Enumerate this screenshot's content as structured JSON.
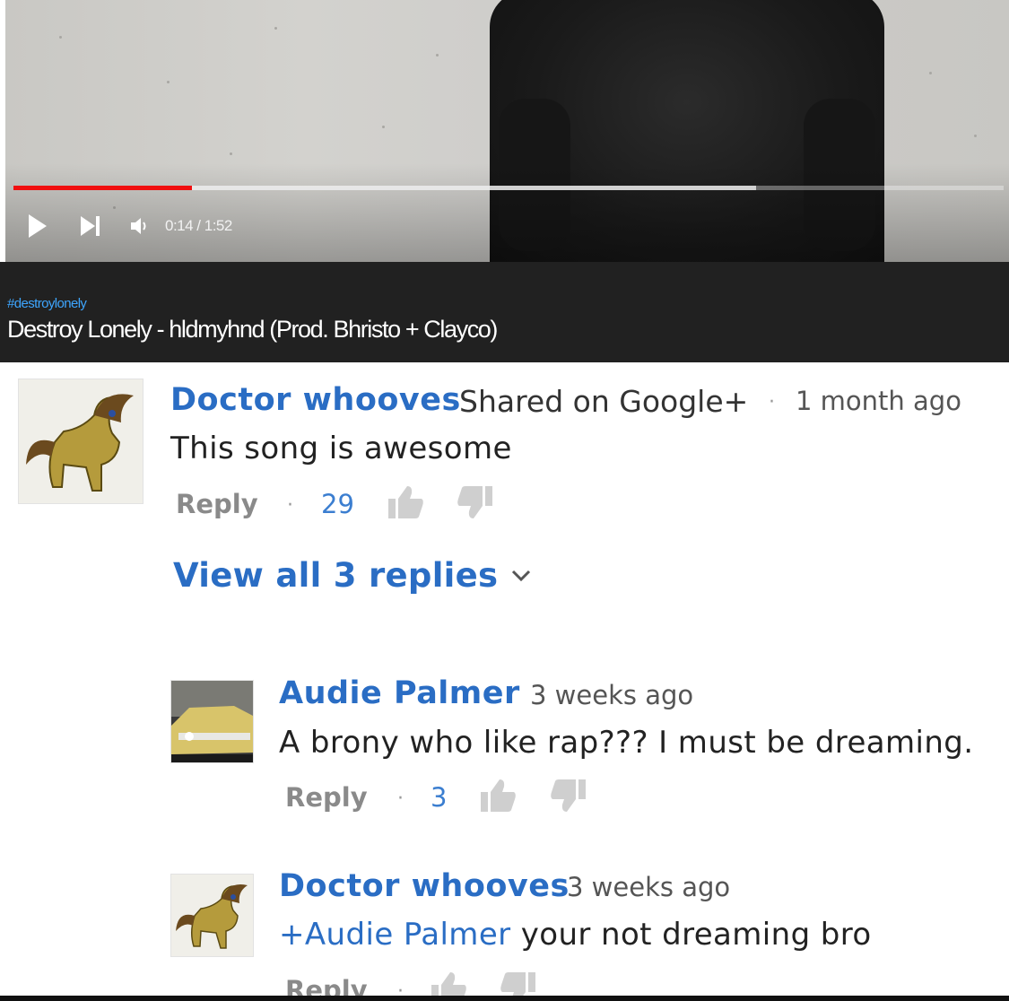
{
  "player": {
    "current_time": "0:14",
    "duration": "1:52",
    "time_display": "0:14 / 1:52",
    "played_fraction": 0.18,
    "buffered_fraction": 0.75,
    "icons": [
      "play-icon",
      "next-icon",
      "volume-icon"
    ]
  },
  "video": {
    "hashtag": "#destroylonely",
    "title": "Destroy Lonely - hldmyhnd (Prod. Bhristo + Clayco)"
  },
  "comments": [
    {
      "author": "Doctor whooves",
      "shared": "Shared on Google+",
      "dot": "·",
      "time": "1 month ago",
      "text": "This song is awesome",
      "reply": "Reply",
      "likes": "29",
      "view_replies": "View all 3 replies"
    }
  ],
  "replies": [
    {
      "author": "Audie Palmer",
      "time": "3 weeks ago",
      "text": "A brony who like rap??? I must be dreaming.",
      "reply": "Reply",
      "likes": "3"
    },
    {
      "author": "Doctor whooves",
      "time": "3 weeks ago",
      "mention": "+Audie Palmer",
      "text": " your not dreaming bro",
      "reply": "Reply"
    }
  ],
  "colors": {
    "link_blue": "#2a6dc4",
    "progress_red": "#f10f0f",
    "title_bar": "#212121",
    "hashtag_blue": "#3ea6ff"
  }
}
